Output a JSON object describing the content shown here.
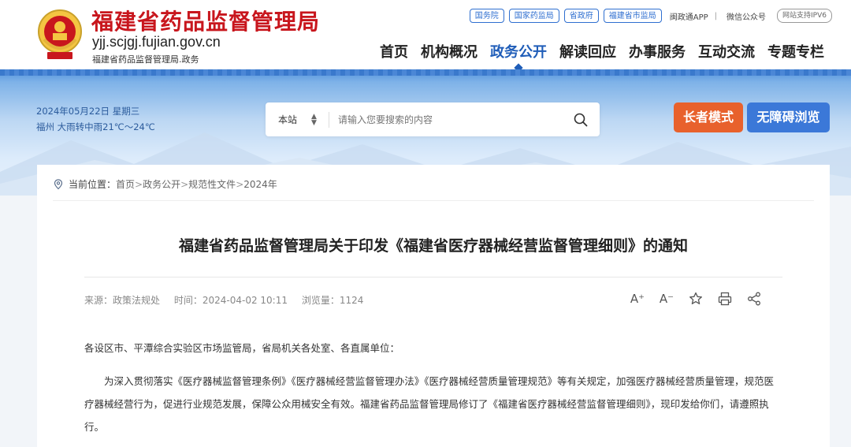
{
  "header": {
    "title": "福建省药品监督管理局",
    "domain": "yjj.scjgj.fujian.gov.cn",
    "subtitle": "福建省药品监督管理局.政务",
    "top_links": [
      "国务院",
      "国家药监局",
      "省政府",
      "福建省市监局"
    ],
    "app_link": "闽政通APP",
    "separator": "|",
    "wechat_link": "微信公众号",
    "ipv6_badge": "网站支持IPV6",
    "nav": [
      "首页",
      "机构概况",
      "政务公开",
      "解读回应",
      "办事服务",
      "互动交流",
      "专题专栏"
    ],
    "active_nav": "政务公开"
  },
  "banner": {
    "date": "2024年05月22日 星期三",
    "weather": "福州 大雨转中雨21℃～24℃",
    "search_scope": "本站",
    "search_placeholder": "请输入您要搜索的内容",
    "elder_mode": "长者模式",
    "accessibility": "无障碍浏览"
  },
  "breadcrumb": {
    "label": "当前位置：",
    "items": [
      "首页",
      "政务公开",
      "规范性文件",
      "2024年"
    ],
    "separator": ">"
  },
  "article": {
    "title": "福建省药品监督管理局关于印发《福建省医疗器械经营监督管理细则》的通知",
    "source": "来源：政策法规处",
    "time": "时间：2024-04-02 10:11",
    "views": "浏览量：1124",
    "salutation": "各设区市、平潭综合实验区市场监管局，省局机关各处室、各直属单位：",
    "body": "为深入贯彻落实《医疗器械监督管理条例》《医疗器械经营监督管理办法》《医疗器械经营质量管理规范》等有关规定，加强医疗器械经营质量管理，规范医疗器械经营行为，促进行业规范发展，保障公众用械安全有效。福建省药品监督管理局修订了《福建省医疗器械经营监督管理细则》，现印发给你们，请遵照执行。"
  },
  "tools": {
    "font_up": "A⁺",
    "font_down": "A⁻"
  },
  "colors": {
    "brand_red": "#c8161d",
    "nav_blue": "#1f5db8",
    "elder_orange": "#e8612c",
    "access_blue": "#3b78d8"
  }
}
